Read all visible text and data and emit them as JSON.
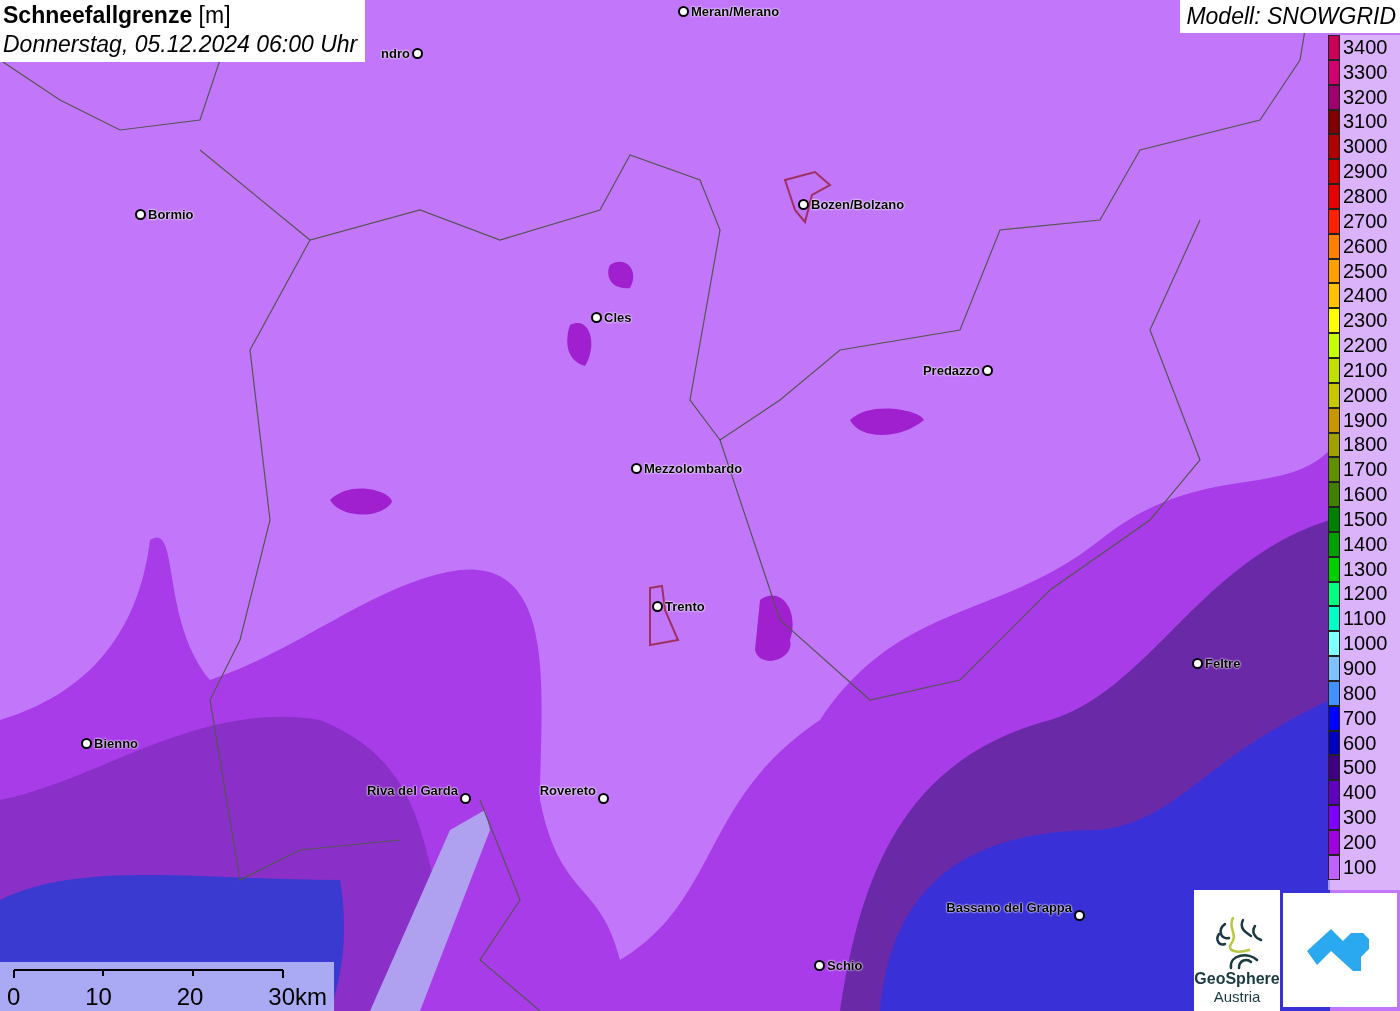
{
  "title": {
    "parameter": "Schneefallgrenze",
    "unit": "[m]",
    "datetime": "Donnerstag, 05.12.2024 06:00 Uhr"
  },
  "model": "Modell: SNOWGRID",
  "cities": [
    {
      "name": "Meran/Merano"
    },
    {
      "name": "ndro"
    },
    {
      "name": "Bormio"
    },
    {
      "name": "Bozen/Bolzano"
    },
    {
      "name": "Cles"
    },
    {
      "name": "Predazzo"
    },
    {
      "name": "Mezzolombardo"
    },
    {
      "name": "Trento"
    },
    {
      "name": "Feltre"
    },
    {
      "name": "Bienno"
    },
    {
      "name": "Riva del Garda"
    },
    {
      "name": "Rovereto"
    },
    {
      "name": "Bassano del Grappa"
    },
    {
      "name": "Schio"
    }
  ],
  "legend": [
    {
      "label": "3400",
      "color": "#c8005a"
    },
    {
      "label": "3300",
      "color": "#d0006e"
    },
    {
      "label": "3200",
      "color": "#a0006e"
    },
    {
      "label": "3100",
      "color": "#800000"
    },
    {
      "label": "3000",
      "color": "#b00000"
    },
    {
      "label": "2900",
      "color": "#d00000"
    },
    {
      "label": "2800",
      "color": "#e80000"
    },
    {
      "label": "2700",
      "color": "#ff2000"
    },
    {
      "label": "2600",
      "color": "#ff8000"
    },
    {
      "label": "2500",
      "color": "#ffa000"
    },
    {
      "label": "2400",
      "color": "#ffc000"
    },
    {
      "label": "2300",
      "color": "#ffff00"
    },
    {
      "label": "2200",
      "color": "#c8ff00"
    },
    {
      "label": "2100",
      "color": "#c0e000"
    },
    {
      "label": "2000",
      "color": "#c8c800"
    },
    {
      "label": "1900",
      "color": "#c89600"
    },
    {
      "label": "1800",
      "color": "#a0a000"
    },
    {
      "label": "1700",
      "color": "#609000"
    },
    {
      "label": "1600",
      "color": "#408000"
    },
    {
      "label": "1500",
      "color": "#008000"
    },
    {
      "label": "1400",
      "color": "#00a000"
    },
    {
      "label": "1300",
      "color": "#00d000"
    },
    {
      "label": "1200",
      "color": "#00ff80"
    },
    {
      "label": "1100",
      "color": "#00ffc8"
    },
    {
      "label": "1000",
      "color": "#80ffff"
    },
    {
      "label": "900",
      "color": "#80c0ff"
    },
    {
      "label": "800",
      "color": "#4090ff"
    },
    {
      "label": "700",
      "color": "#0000ff"
    },
    {
      "label": "600",
      "color": "#0000c0"
    },
    {
      "label": "500",
      "color": "#400080"
    },
    {
      "label": "400",
      "color": "#6000c0"
    },
    {
      "label": "300",
      "color": "#8000ff"
    },
    {
      "label": "200",
      "color": "#a000e0"
    },
    {
      "label": "100",
      "color": "#c060ff"
    }
  ],
  "scale": {
    "ticks": [
      "0",
      "10",
      "20",
      "30km"
    ]
  },
  "logo": {
    "name": "GeoSphere",
    "subtitle": "Austria"
  }
}
